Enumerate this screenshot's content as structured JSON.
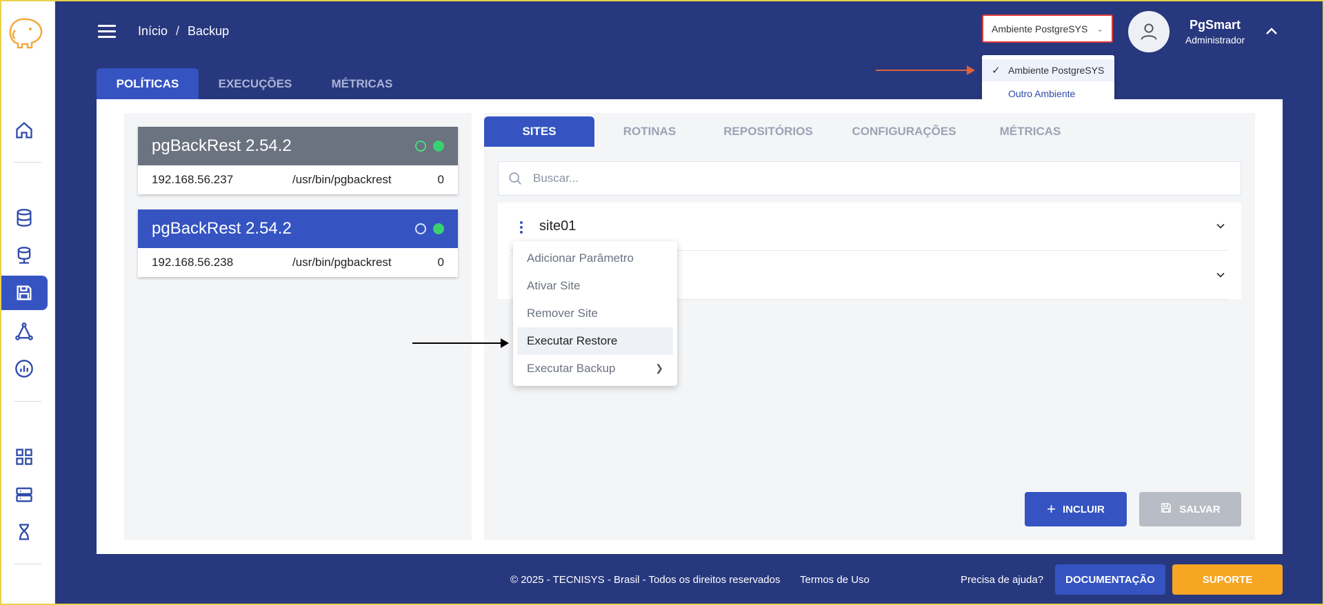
{
  "breadcrumb": {
    "home": "Início",
    "separator": "/",
    "current": "Backup"
  },
  "environment": {
    "selected": "Ambiente PostgreSYS",
    "options": [
      "Ambiente PostgreSYS",
      "Outro Ambiente"
    ]
  },
  "user": {
    "name": "PgSmart",
    "role": "Administrador"
  },
  "top_tabs": [
    "POLÍTICAS",
    "EXECUÇÕES",
    "MÉTRICAS"
  ],
  "servers": [
    {
      "title": "pgBackRest 2.54.2",
      "ip": "192.168.56.237",
      "path": "/usr/bin/pgbackrest",
      "count": "0"
    },
    {
      "title": "pgBackRest 2.54.2",
      "ip": "192.168.56.238",
      "path": "/usr/bin/pgbackrest",
      "count": "0"
    }
  ],
  "sub_tabs": [
    "SITES",
    "ROTINAS",
    "REPOSITÓRIOS",
    "CONFIGURAÇÕES",
    "MÉTRICAS"
  ],
  "search": {
    "placeholder": "Buscar..."
  },
  "sites": [
    {
      "name": "site01"
    }
  ],
  "context_menu": [
    "Adicionar Parâmetro",
    "Ativar Site",
    "Remover Site",
    "Executar Restore",
    "Executar Backup"
  ],
  "buttons": {
    "include": "INCLUIR",
    "save": "SALVAR"
  },
  "footer": {
    "copyright": "© 2025 - TECNISYS - Brasil - Todos os direitos reservados",
    "terms": "Termos de Uso",
    "help": "Precisa de ajuda?",
    "docs": "DOCUMENTAÇÃO",
    "support": "SUPORTE"
  },
  "colors": {
    "primary": "#3554c2",
    "header_bg": "#27387e",
    "support": "#f6a623",
    "status_ok": "#39d26f",
    "annotation_arrow": "#e0643a"
  },
  "icons": [
    "elephant-logo-icon",
    "home-icon",
    "database-icon",
    "database-server-icon",
    "backup-save-icon",
    "network-icon",
    "chart-icon",
    "grid-icon",
    "server-icon",
    "hourglass-icon"
  ]
}
